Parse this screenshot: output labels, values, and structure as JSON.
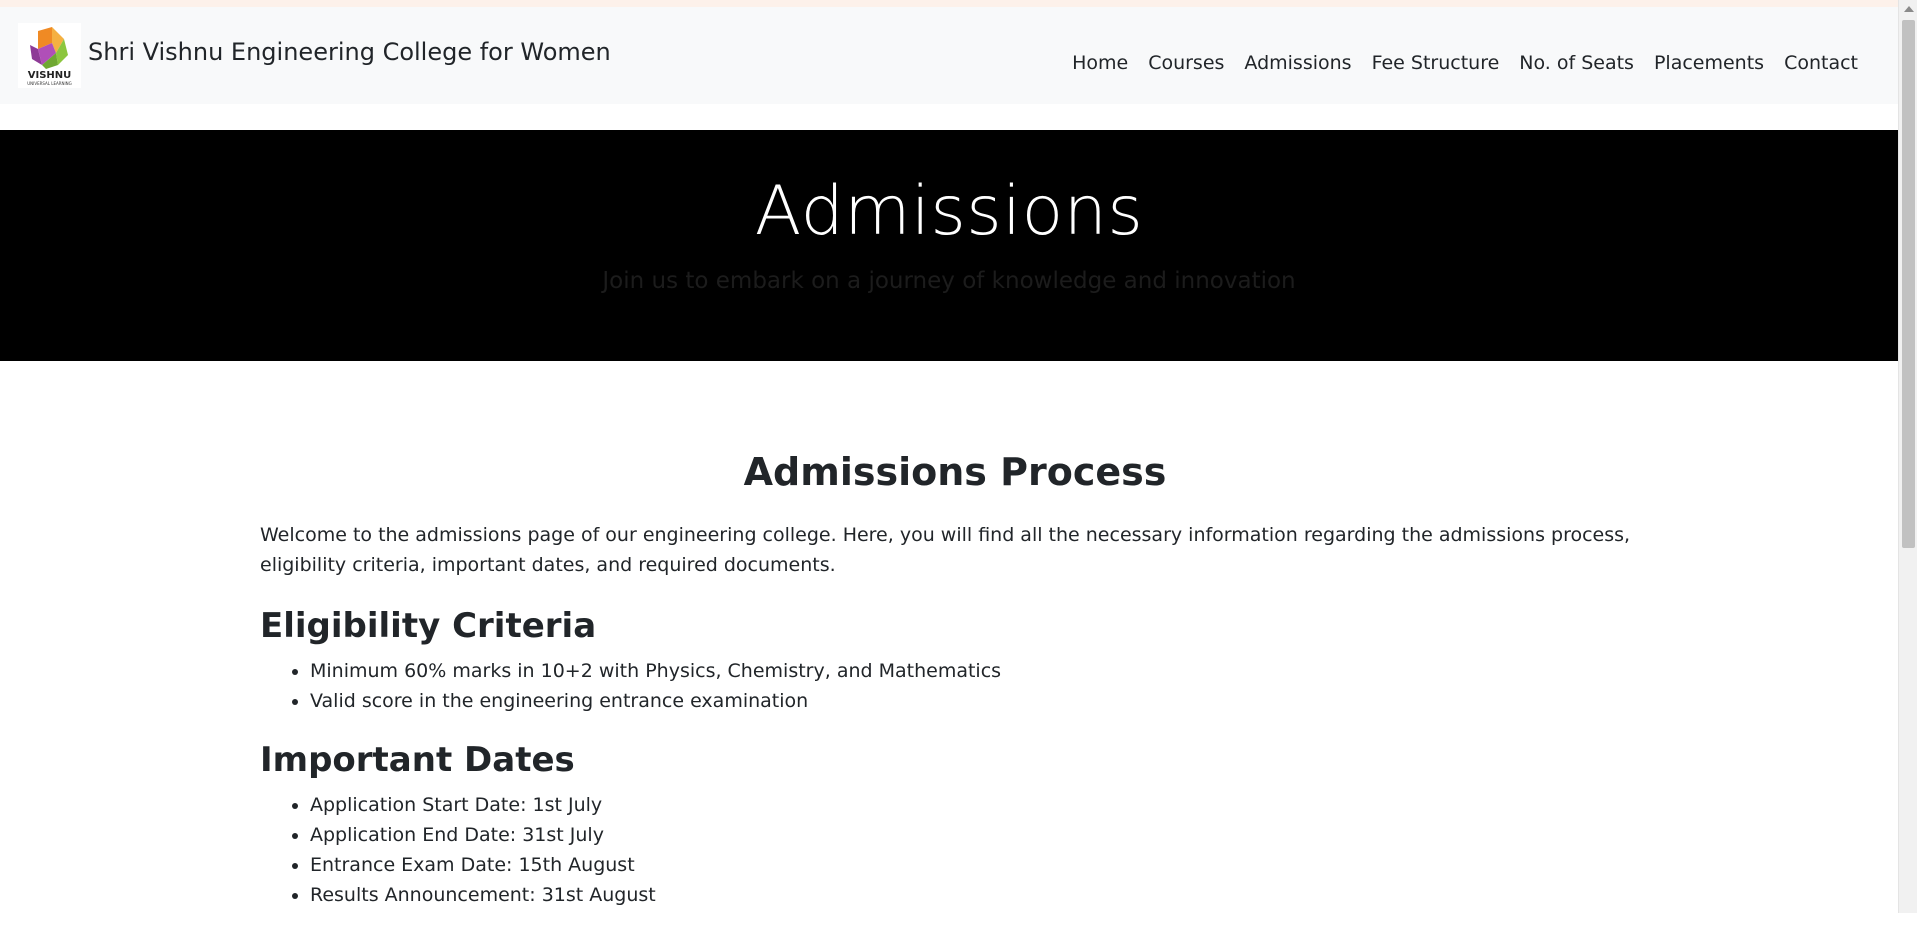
{
  "header": {
    "brand": "Shri Vishnu Engineering College for Women",
    "logo_text": "VISHNU",
    "logo_subtext": "UNIVERSAL LEARNING",
    "nav": [
      {
        "label": "Home"
      },
      {
        "label": "Courses"
      },
      {
        "label": "Admissions"
      },
      {
        "label": "Fee Structure"
      },
      {
        "label": "No. of Seats"
      },
      {
        "label": "Placements"
      },
      {
        "label": "Contact"
      }
    ]
  },
  "hero": {
    "title": "Admissions",
    "subtitle": "Join us to embark on a journey of knowledge and innovation"
  },
  "main": {
    "process_title": "Admissions Process",
    "intro": "Welcome to the admissions page of our engineering college. Here, you will find all the necessary information regarding the admissions process, eligibility criteria, important dates, and required documents.",
    "eligibility": {
      "title": "Eligibility Criteria",
      "items": [
        "Minimum 60% marks in 10+2 with Physics, Chemistry, and Mathematics",
        "Valid score in the engineering entrance examination"
      ]
    },
    "dates": {
      "title": "Important Dates",
      "items": [
        "Application Start Date: 1st July",
        "Application End Date: 31st July",
        "Entrance Exam Date: 15th August",
        "Results Announcement: 31st August"
      ]
    }
  },
  "colors": {
    "navbar_bg": "#f8f9fa",
    "hero_bg": "#000000",
    "logo_orange": "#f08a24",
    "logo_purple": "#8e3a96",
    "logo_green": "#8cc63f"
  }
}
